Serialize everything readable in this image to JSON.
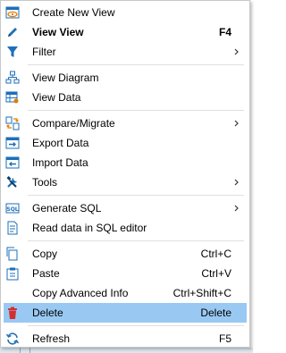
{
  "menu": {
    "items": [
      {
        "label": "Create New View",
        "shortcut": "",
        "submenu": false,
        "icon": "eye-create-icon"
      },
      {
        "label": "View View",
        "shortcut": "F4",
        "submenu": false,
        "icon": "pencil-icon"
      },
      {
        "label": "Filter",
        "shortcut": "",
        "submenu": true,
        "icon": "funnel-icon"
      },
      {
        "label": "View Diagram",
        "shortcut": "",
        "submenu": false,
        "icon": "diagram-icon"
      },
      {
        "label": "View Data",
        "shortcut": "",
        "submenu": false,
        "icon": "table-view-icon"
      },
      {
        "label": "Compare/Migrate",
        "shortcut": "",
        "submenu": true,
        "icon": "compare-icon"
      },
      {
        "label": "Export Data",
        "shortcut": "",
        "submenu": false,
        "icon": "export-icon"
      },
      {
        "label": "Import Data",
        "shortcut": "",
        "submenu": false,
        "icon": "import-icon"
      },
      {
        "label": "Tools",
        "shortcut": "",
        "submenu": true,
        "icon": "tools-icon"
      },
      {
        "label": "Generate SQL",
        "shortcut": "",
        "submenu": true,
        "icon": "sql-icon"
      },
      {
        "label": "Read data in SQL editor",
        "shortcut": "",
        "submenu": false,
        "icon": "sql-editor-icon"
      },
      {
        "label": "Copy",
        "shortcut": "Ctrl+C",
        "submenu": false,
        "icon": "copy-icon"
      },
      {
        "label": "Paste",
        "shortcut": "Ctrl+V",
        "submenu": false,
        "icon": "paste-icon"
      },
      {
        "label": "Copy Advanced Info",
        "shortcut": "Ctrl+Shift+C",
        "submenu": false,
        "icon": ""
      },
      {
        "label": "Delete",
        "shortcut": "Delete",
        "submenu": false,
        "icon": "trash-icon"
      },
      {
        "label": "Refresh",
        "shortcut": "F5",
        "submenu": false,
        "icon": "refresh-icon"
      }
    ],
    "selected_index": 14,
    "colors": {
      "highlight": "#99c9f3",
      "icon_blue": "#1e6fb8",
      "delete_red": "#d32f2f"
    }
  }
}
